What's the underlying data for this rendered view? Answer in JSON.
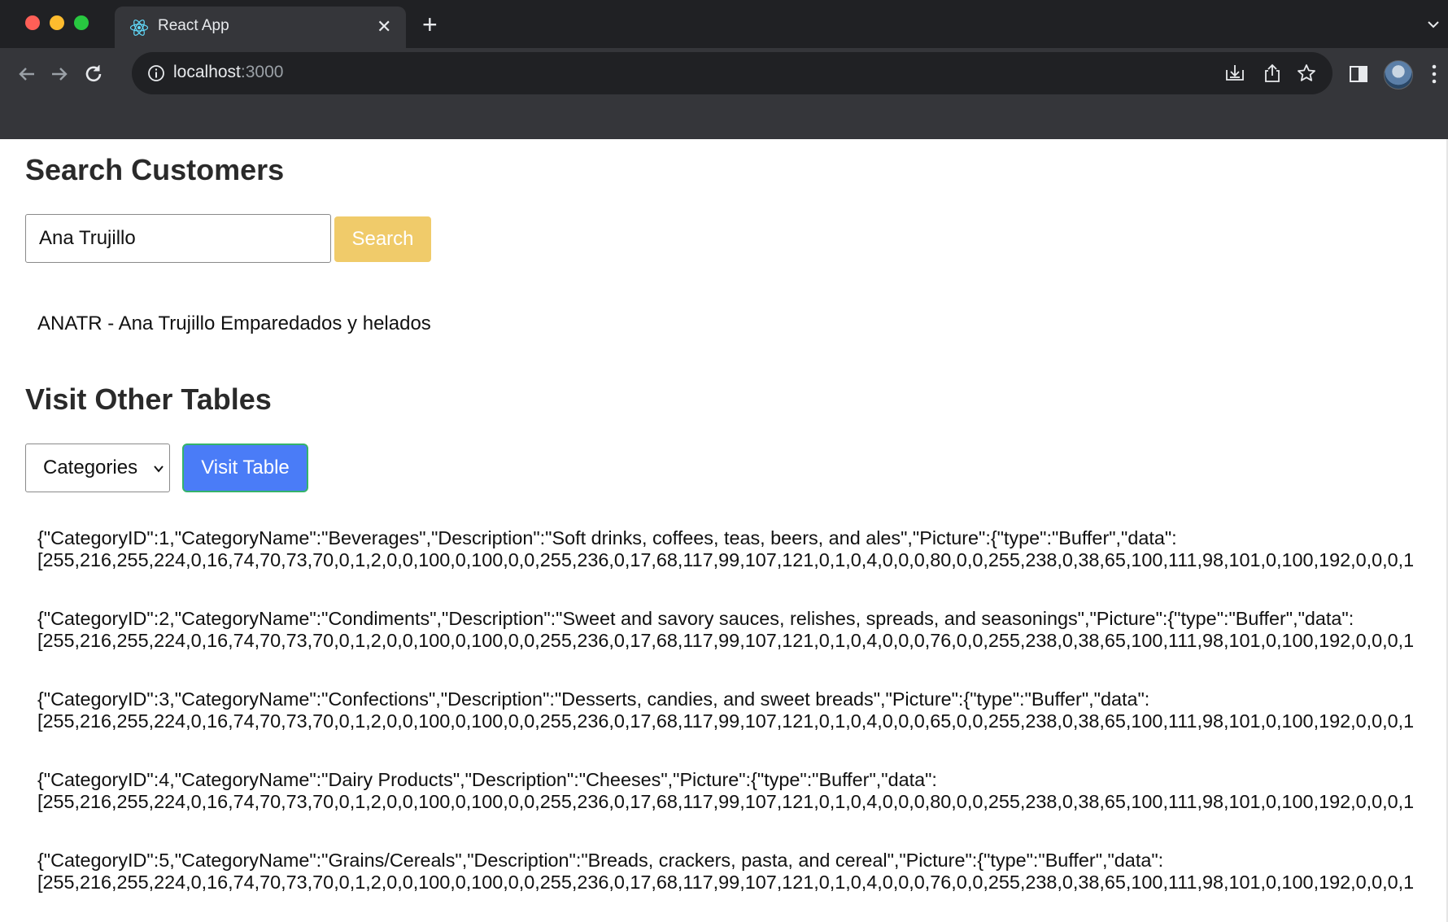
{
  "browser": {
    "tab_title": "React App",
    "tab_close": "✕",
    "new_tab": "+",
    "url_host": "localhost",
    "url_port": ":3000"
  },
  "search": {
    "heading": "Search Customers",
    "input_value": "Ana Trujillo",
    "button_label": "Search",
    "result": "ANATR - Ana Trujillo Emparedados y helados"
  },
  "tables": {
    "heading": "Visit Other Tables",
    "selected": "Categories",
    "button_label": "Visit Table",
    "rows": [
      {
        "line1": "{\"CategoryID\":1,\"CategoryName\":\"Beverages\",\"Description\":\"Soft drinks, coffees, teas, beers, and ales\",\"Picture\":{\"type\":\"Buffer\",\"data\":",
        "line2": "[255,216,255,224,0,16,74,70,73,70,0,1,2,0,0,100,0,100,0,0,255,236,0,17,68,117,99,107,121,0,1,0,4,0,0,0,80,0,0,255,238,0,38,65,100,111,98,101,0,100,192,0,0,0,1"
      },
      {
        "line1": "{\"CategoryID\":2,\"CategoryName\":\"Condiments\",\"Description\":\"Sweet and savory sauces, relishes, spreads, and seasonings\",\"Picture\":{\"type\":\"Buffer\",\"data\":",
        "line2": "[255,216,255,224,0,16,74,70,73,70,0,1,2,0,0,100,0,100,0,0,255,236,0,17,68,117,99,107,121,0,1,0,4,0,0,0,76,0,0,255,238,0,38,65,100,111,98,101,0,100,192,0,0,0,1"
      },
      {
        "line1": "{\"CategoryID\":3,\"CategoryName\":\"Confections\",\"Description\":\"Desserts, candies, and sweet breads\",\"Picture\":{\"type\":\"Buffer\",\"data\":",
        "line2": "[255,216,255,224,0,16,74,70,73,70,0,1,2,0,0,100,0,100,0,0,255,236,0,17,68,117,99,107,121,0,1,0,4,0,0,0,65,0,0,255,238,0,38,65,100,111,98,101,0,100,192,0,0,0,1"
      },
      {
        "line1": "{\"CategoryID\":4,\"CategoryName\":\"Dairy Products\",\"Description\":\"Cheeses\",\"Picture\":{\"type\":\"Buffer\",\"data\":",
        "line2": "[255,216,255,224,0,16,74,70,73,70,0,1,2,0,0,100,0,100,0,0,255,236,0,17,68,117,99,107,121,0,1,0,4,0,0,0,80,0,0,255,238,0,38,65,100,111,98,101,0,100,192,0,0,0,1"
      },
      {
        "line1": "{\"CategoryID\":5,\"CategoryName\":\"Grains/Cereals\",\"Description\":\"Breads, crackers, pasta, and cereal\",\"Picture\":{\"type\":\"Buffer\",\"data\":",
        "line2": "[255,216,255,224,0,16,74,70,73,70,0,1,2,0,0,100,0,100,0,0,255,236,0,17,68,117,99,107,121,0,1,0,4,0,0,0,76,0,0,255,238,0,38,65,100,111,98,101,0,100,192,0,0,0,1"
      }
    ]
  }
}
